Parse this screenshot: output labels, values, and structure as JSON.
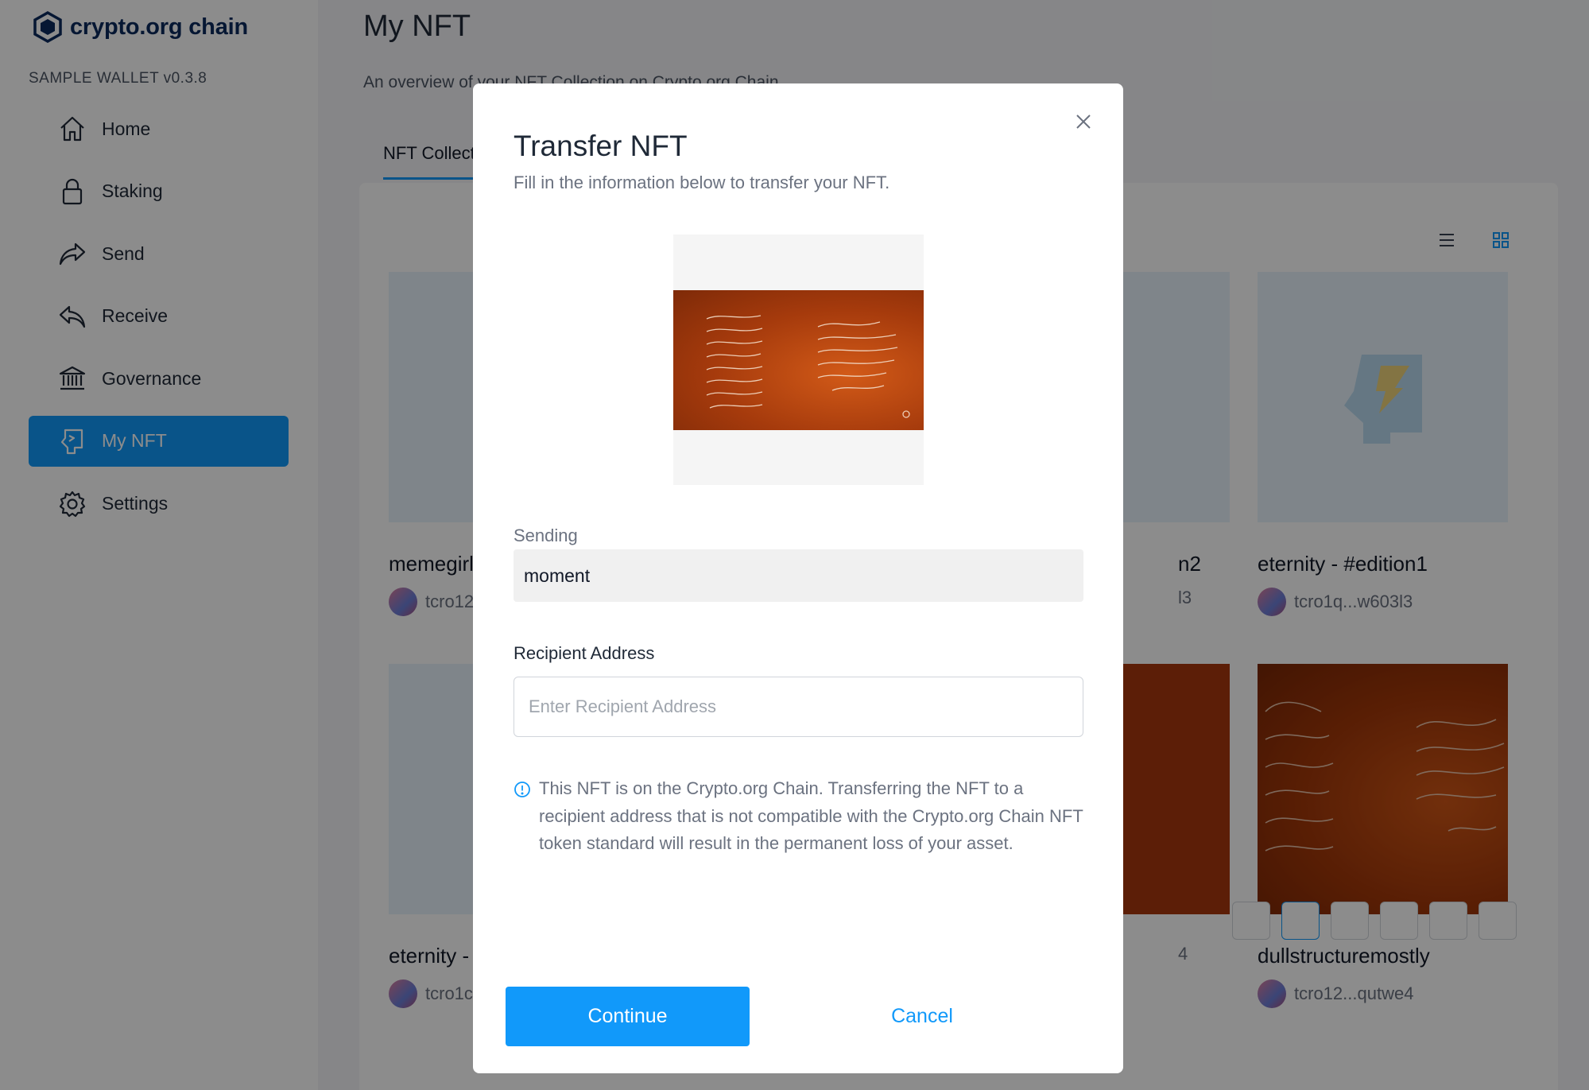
{
  "app": {
    "brand": "crypto.org chain",
    "version": "SAMPLE WALLET v0.3.8",
    "accent_color": "#1199fa",
    "brand_color": "#0b2a5e"
  },
  "sidebar": {
    "items": [
      {
        "label": "Home",
        "icon": "home-icon"
      },
      {
        "label": "Staking",
        "icon": "lock-icon"
      },
      {
        "label": "Send",
        "icon": "send-icon"
      },
      {
        "label": "Receive",
        "icon": "receive-icon"
      },
      {
        "label": "Governance",
        "icon": "bank-icon"
      },
      {
        "label": "My NFT",
        "icon": "nft-icon",
        "active": true
      },
      {
        "label": "Settings",
        "icon": "gear-icon"
      }
    ]
  },
  "page": {
    "title": "My NFT",
    "subtitle": "An overview of your NFT Collection on Crypto.org Chain",
    "tab": "NFT Collection"
  },
  "nft_cards": [
    {
      "name": "memegirl",
      "owner": "tcro12"
    },
    {
      "name": "n2",
      "owner": "l3"
    },
    {
      "name": "eternity - #edition1",
      "owner": "tcro1q...w603l3"
    },
    {
      "name": "eternity -",
      "owner": "tcro1c"
    },
    {
      "name": "",
      "owner": "4"
    },
    {
      "name": "dullstructuremostly",
      "owner": "tcro12...qutwe4"
    }
  ],
  "modal": {
    "title": "Transfer NFT",
    "subtitle": "Fill in the information below to transfer your NFT.",
    "sending_label": "Sending",
    "sending_value": "moment",
    "recipient_label": "Recipient Address",
    "recipient_placeholder": "Enter Recipient Address",
    "recipient_value": "",
    "notice": "This NFT is on the Crypto.org Chain. Transferring the NFT to a recipient address that is not compatible with the Crypto.org Chain NFT token standard will result in the permanent loss of your asset.",
    "continue_label": "Continue",
    "cancel_label": "Cancel"
  }
}
